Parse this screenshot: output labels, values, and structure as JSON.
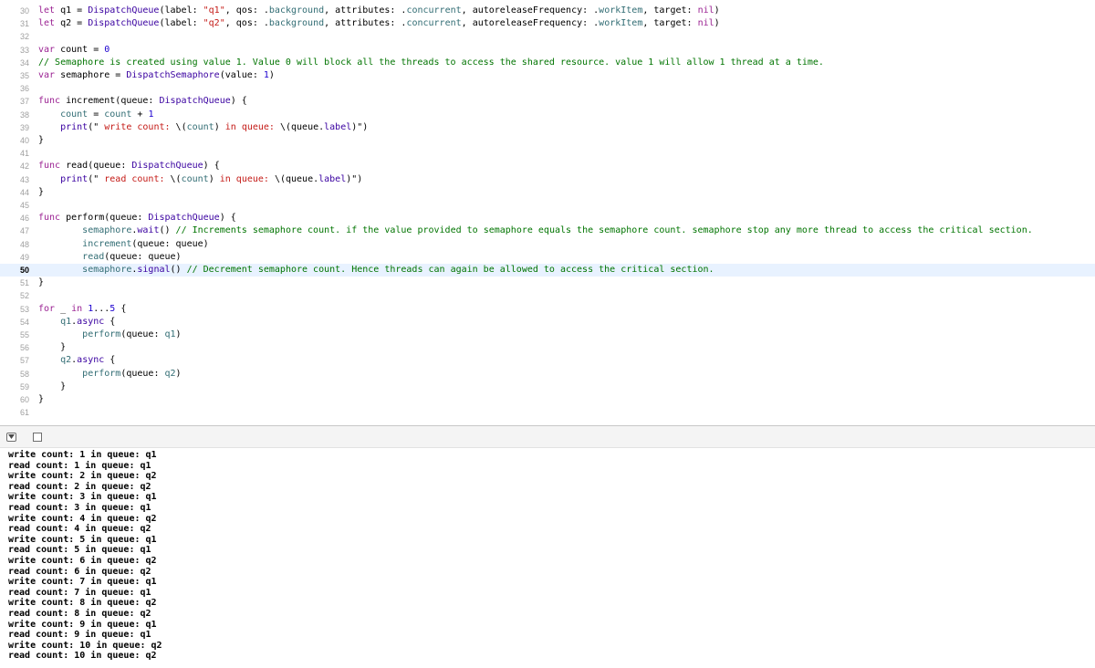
{
  "editor": {
    "current_line": "50",
    "lines": [
      {
        "number": "30",
        "tokens": [
          {
            "t": "let",
            "c": "kw"
          },
          {
            "t": " q1 = "
          },
          {
            "t": "DispatchQueue",
            "c": "type"
          },
          {
            "t": "(label: "
          },
          {
            "t": "\"q1\"",
            "c": "str"
          },
          {
            "t": ", qos: ."
          },
          {
            "t": "background",
            "c": "id"
          },
          {
            "t": ", attributes: ."
          },
          {
            "t": "concurrent",
            "c": "id"
          },
          {
            "t": ", autoreleaseFrequency: ."
          },
          {
            "t": "workItem",
            "c": "id"
          },
          {
            "t": ", target: "
          },
          {
            "t": "nil",
            "c": "kw"
          },
          {
            "t": ")"
          }
        ]
      },
      {
        "number": "31",
        "tokens": [
          {
            "t": "let",
            "c": "kw"
          },
          {
            "t": " q2 = "
          },
          {
            "t": "DispatchQueue",
            "c": "type"
          },
          {
            "t": "(label: "
          },
          {
            "t": "\"q2\"",
            "c": "str"
          },
          {
            "t": ", qos: ."
          },
          {
            "t": "background",
            "c": "id"
          },
          {
            "t": ", attributes: ."
          },
          {
            "t": "concurrent",
            "c": "id"
          },
          {
            "t": ", autoreleaseFrequency: ."
          },
          {
            "t": "workItem",
            "c": "id"
          },
          {
            "t": ", target: "
          },
          {
            "t": "nil",
            "c": "kw"
          },
          {
            "t": ")"
          }
        ]
      },
      {
        "number": "32",
        "tokens": []
      },
      {
        "number": "33",
        "tokens": [
          {
            "t": "var",
            "c": "kw"
          },
          {
            "t": " count = "
          },
          {
            "t": "0",
            "c": "num"
          }
        ]
      },
      {
        "number": "34",
        "tokens": [
          {
            "t": "// Semaphore is created using value 1. Value 0 will block all the threads to access the shared resource. value 1 will allow 1 thread at a time.",
            "c": "com"
          }
        ]
      },
      {
        "number": "35",
        "tokens": [
          {
            "t": "var",
            "c": "kw"
          },
          {
            "t": " semaphore = "
          },
          {
            "t": "DispatchSemaphore",
            "c": "type"
          },
          {
            "t": "(value: "
          },
          {
            "t": "1",
            "c": "num"
          },
          {
            "t": ")"
          }
        ]
      },
      {
        "number": "36",
        "tokens": []
      },
      {
        "number": "37",
        "tokens": [
          {
            "t": "func",
            "c": "kw"
          },
          {
            "t": " increment(queue: "
          },
          {
            "t": "DispatchQueue",
            "c": "type"
          },
          {
            "t": ") {"
          }
        ]
      },
      {
        "number": "38",
        "tokens": [
          {
            "t": "    "
          },
          {
            "t": "count",
            "c": "id"
          },
          {
            "t": " = "
          },
          {
            "t": "count",
            "c": "id"
          },
          {
            "t": " + "
          },
          {
            "t": "1",
            "c": "num"
          }
        ]
      },
      {
        "number": "39",
        "tokens": [
          {
            "t": "    "
          },
          {
            "t": "print",
            "c": "type"
          },
          {
            "t": "(\""
          },
          {
            "t": " write count: ",
            "c": "str"
          },
          {
            "t": "\\("
          },
          {
            "t": "count",
            "c": "id"
          },
          {
            "t": ")"
          },
          {
            "t": " in queue: ",
            "c": "str"
          },
          {
            "t": "\\(queue."
          },
          {
            "t": "label",
            "c": "type"
          },
          {
            "t": ")\")"
          }
        ]
      },
      {
        "number": "40",
        "tokens": [
          {
            "t": "}"
          }
        ]
      },
      {
        "number": "41",
        "tokens": []
      },
      {
        "number": "42",
        "tokens": [
          {
            "t": "func",
            "c": "kw"
          },
          {
            "t": " read(queue: "
          },
          {
            "t": "DispatchQueue",
            "c": "type"
          },
          {
            "t": ") {"
          }
        ]
      },
      {
        "number": "43",
        "tokens": [
          {
            "t": "    "
          },
          {
            "t": "print",
            "c": "type"
          },
          {
            "t": "(\""
          },
          {
            "t": " read count: ",
            "c": "str"
          },
          {
            "t": "\\("
          },
          {
            "t": "count",
            "c": "id"
          },
          {
            "t": ")"
          },
          {
            "t": " in queue: ",
            "c": "str"
          },
          {
            "t": "\\(queue."
          },
          {
            "t": "label",
            "c": "type"
          },
          {
            "t": ")\")"
          }
        ]
      },
      {
        "number": "44",
        "tokens": [
          {
            "t": "}"
          }
        ]
      },
      {
        "number": "45",
        "tokens": []
      },
      {
        "number": "46",
        "tokens": [
          {
            "t": "func",
            "c": "kw"
          },
          {
            "t": " perform(queue: "
          },
          {
            "t": "DispatchQueue",
            "c": "type"
          },
          {
            "t": ") {"
          }
        ]
      },
      {
        "number": "47",
        "tokens": [
          {
            "t": "        "
          },
          {
            "t": "semaphore",
            "c": "id"
          },
          {
            "t": "."
          },
          {
            "t": "wait",
            "c": "type"
          },
          {
            "t": "() "
          },
          {
            "t": "// Increments semaphore count. if the value provided to semaphore equals the semaphore count. semaphore stop any more thread to access the critical section.",
            "c": "com"
          }
        ]
      },
      {
        "number": "48",
        "tokens": [
          {
            "t": "        "
          },
          {
            "t": "increment",
            "c": "id"
          },
          {
            "t": "(queue: queue)"
          }
        ]
      },
      {
        "number": "49",
        "tokens": [
          {
            "t": "        "
          },
          {
            "t": "read",
            "c": "id"
          },
          {
            "t": "(queue: queue)"
          }
        ]
      },
      {
        "number": "50",
        "tokens": [
          {
            "t": "        "
          },
          {
            "t": "semaphore",
            "c": "id"
          },
          {
            "t": "."
          },
          {
            "t": "signal",
            "c": "type"
          },
          {
            "t": "() "
          },
          {
            "t": "// Decrement semaphore count. Hence threads can again be allowed to access the critical section.",
            "c": "com"
          }
        ]
      },
      {
        "number": "51",
        "tokens": [
          {
            "t": "}"
          }
        ]
      },
      {
        "number": "52",
        "tokens": []
      },
      {
        "number": "53",
        "tokens": [
          {
            "t": "for",
            "c": "kw"
          },
          {
            "t": " _ "
          },
          {
            "t": "in",
            "c": "kw"
          },
          {
            "t": " "
          },
          {
            "t": "1",
            "c": "num"
          },
          {
            "t": "..."
          },
          {
            "t": "5",
            "c": "num"
          },
          {
            "t": " {"
          }
        ]
      },
      {
        "number": "54",
        "tokens": [
          {
            "t": "    "
          },
          {
            "t": "q1",
            "c": "id"
          },
          {
            "t": "."
          },
          {
            "t": "async",
            "c": "type"
          },
          {
            "t": " {"
          }
        ]
      },
      {
        "number": "55",
        "tokens": [
          {
            "t": "        "
          },
          {
            "t": "perform",
            "c": "id"
          },
          {
            "t": "(queue: "
          },
          {
            "t": "q1",
            "c": "id"
          },
          {
            "t": ")"
          }
        ]
      },
      {
        "number": "56",
        "tokens": [
          {
            "t": "    }"
          }
        ]
      },
      {
        "number": "57",
        "tokens": [
          {
            "t": "    "
          },
          {
            "t": "q2",
            "c": "id"
          },
          {
            "t": "."
          },
          {
            "t": "async",
            "c": "type"
          },
          {
            "t": " {"
          }
        ]
      },
      {
        "number": "58",
        "tokens": [
          {
            "t": "        "
          },
          {
            "t": "perform",
            "c": "id"
          },
          {
            "t": "(queue: "
          },
          {
            "t": "q2",
            "c": "id"
          },
          {
            "t": ")"
          }
        ]
      },
      {
        "number": "59",
        "tokens": [
          {
            "t": "    }"
          }
        ]
      },
      {
        "number": "60",
        "tokens": [
          {
            "t": "}"
          }
        ]
      },
      {
        "number": "61",
        "tokens": []
      }
    ]
  },
  "debug_bar": {
    "hide_icon": "triangle-down-icon",
    "console_icon": "square-icon"
  },
  "console": {
    "lines": [
      "write count: 1 in queue: q1",
      "read count: 1 in queue: q1",
      "write count: 2 in queue: q2",
      "read count: 2 in queue: q2",
      "write count: 3 in queue: q1",
      "read count: 3 in queue: q1",
      "write count: 4 in queue: q2",
      "read count: 4 in queue: q2",
      "write count: 5 in queue: q1",
      "read count: 5 in queue: q1",
      "write count: 6 in queue: q2",
      "read count: 6 in queue: q2",
      "write count: 7 in queue: q1",
      "read count: 7 in queue: q1",
      "write count: 8 in queue: q2",
      "read count: 8 in queue: q2",
      "write count: 9 in queue: q1",
      "read count: 9 in queue: q1",
      "write count: 10 in queue: q2",
      "read count: 10 in queue: q2"
    ]
  },
  "colors": {
    "keyword": "#9b2393",
    "type": "#3900a0",
    "string": "#c41a16",
    "number": "#1c00cf",
    "comment": "#007400",
    "identifier": "#326d74",
    "current_line_highlight": "#e8f2ff"
  }
}
